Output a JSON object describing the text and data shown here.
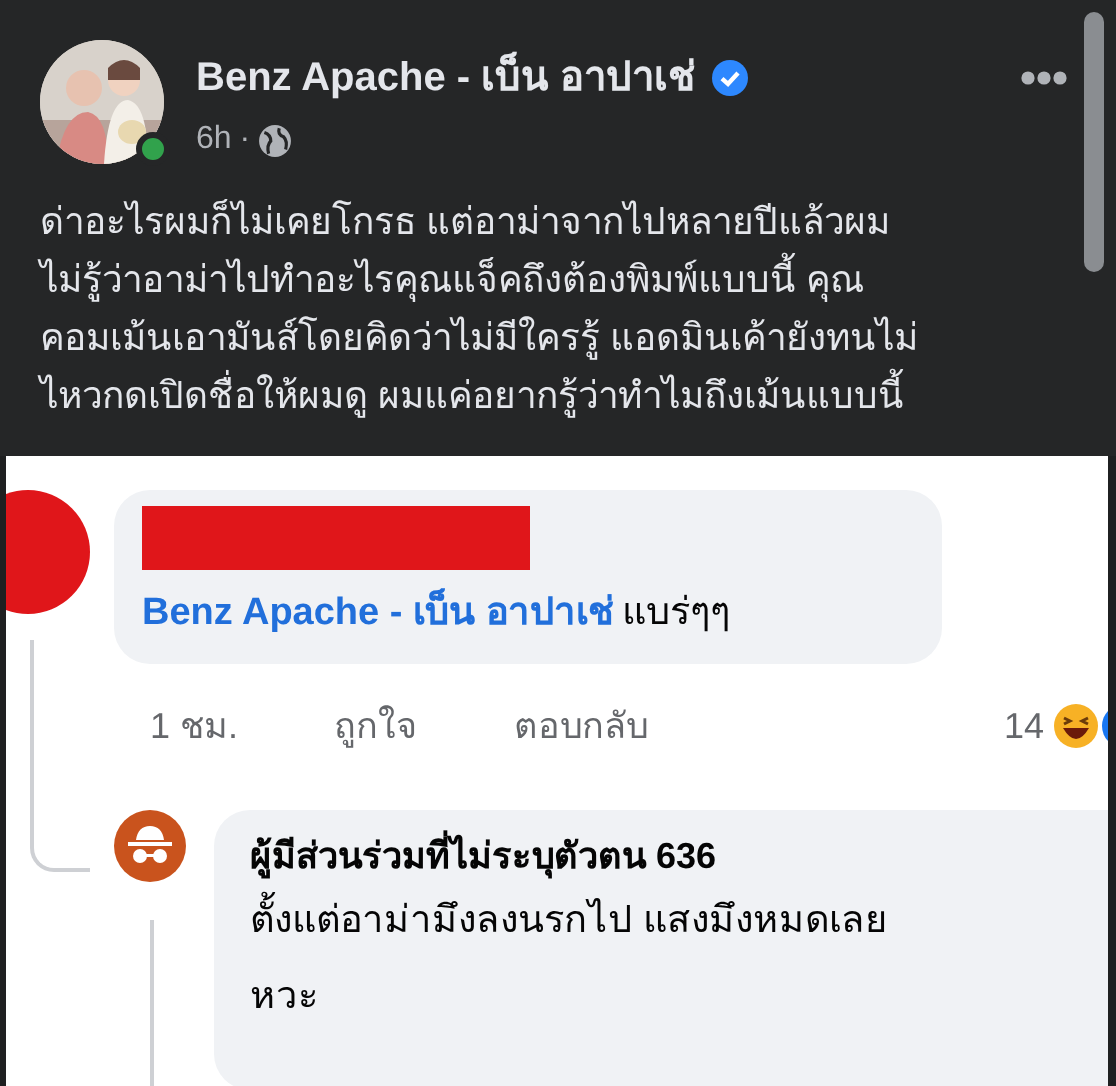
{
  "post": {
    "author": "Benz Apache - เบ็น อาปาเช่",
    "verified": true,
    "online": true,
    "time": "6h",
    "separator": "·",
    "text": "ด่าอะไรผมก็ไม่เคยโกรธ แต่อาม่าจากไปหลายปีแล้วผม\nไม่รู้ว่าอาม่าไปทำอะไรคุณแจ็คถึงต้องพิมพ์แบบนี้ คุณ\nคอมเม้นเอามันส์โดยคิดว่าไม่มีใครรู้ แอดมินเค้ายังทนไม่\nไหวกดเปิดชื่อให้ผมดู ผมแค่อยากรู้ว่าทำไมถึงเม้นแบบนี้"
  },
  "comments": [
    {
      "kind": "redacted",
      "mention": "Benz Apache - เบ็น อาปาเช่",
      "text": "แบร่ๆๆ",
      "time": "1 ชม.",
      "actions": [
        "ถูกใจ",
        "ตอบกลับ"
      ],
      "reaction_count": "14"
    },
    {
      "kind": "anonymous",
      "author": "ผู้มีส่วนร่วมที่ไม่ระบุตัวตน 636",
      "text": "ตั้งแต่อาม่ามึงลงนรกไป แสงมึงหมดเลย\nหวะ"
    }
  ]
}
